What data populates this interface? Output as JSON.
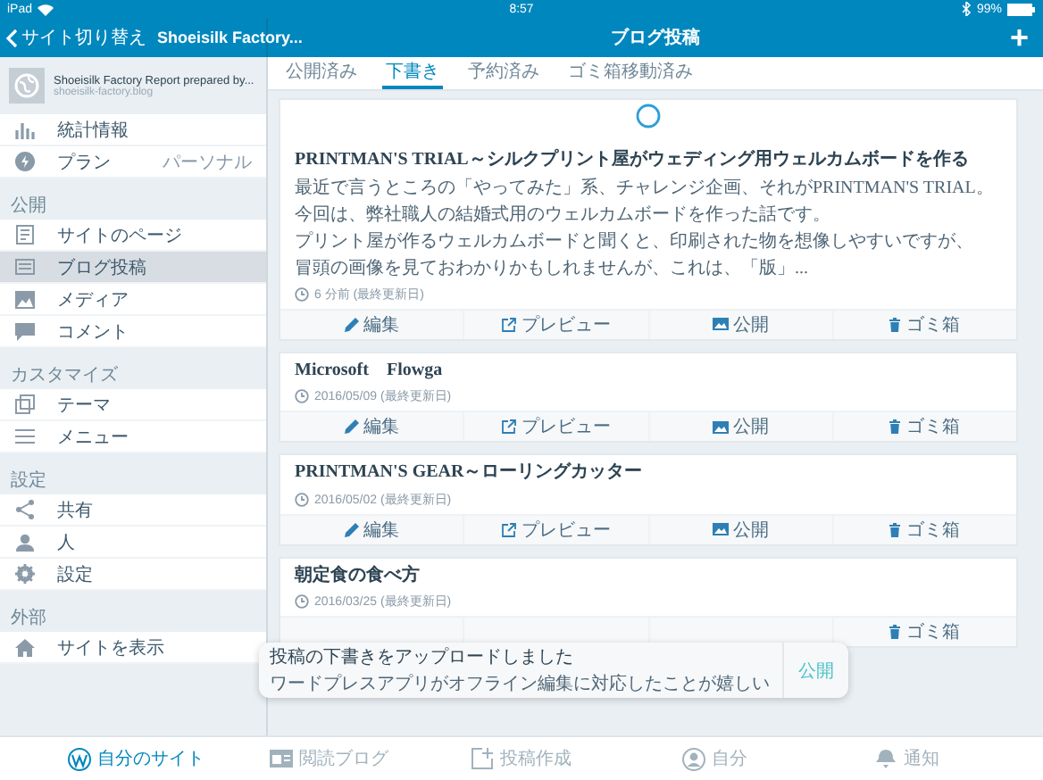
{
  "status_bar": {
    "device": "iPad",
    "time": "8:57",
    "battery": "99%"
  },
  "header": {
    "back": "サイト切り替え",
    "site": "Shoeisilk Factory...",
    "title": "ブログ投稿",
    "add": "+"
  },
  "site": {
    "name": "Shoeisilk Factory Report prepared by...",
    "url": "shoeisilk-factory.blog"
  },
  "sidebar": {
    "sections": [
      {
        "items": [
          {
            "label": "統計情報",
            "selected": false
          },
          {
            "label": "プラン",
            "value": "パーソナル",
            "selected": false
          }
        ]
      },
      {
        "title": "公開",
        "items": [
          {
            "label": "サイトのページ",
            "selected": false
          },
          {
            "label": "ブログ投稿",
            "selected": true
          },
          {
            "label": "メディア",
            "selected": false
          },
          {
            "label": "コメント",
            "selected": false
          }
        ]
      },
      {
        "title": "カスタマイズ",
        "items": [
          {
            "label": "テーマ",
            "selected": false
          },
          {
            "label": "メニュー",
            "selected": false
          }
        ]
      },
      {
        "title": "設定",
        "items": [
          {
            "label": "共有",
            "selected": false
          },
          {
            "label": "人",
            "selected": false
          },
          {
            "label": "設定",
            "selected": false
          }
        ]
      },
      {
        "title": "外部",
        "items": [
          {
            "label": "サイトを表示",
            "selected": false
          }
        ]
      }
    ]
  },
  "tabs": [
    {
      "label": "公開済み",
      "selected": false
    },
    {
      "label": "下書き",
      "selected": true
    },
    {
      "label": "予約済み",
      "selected": false
    },
    {
      "label": "ゴミ箱移動済み",
      "selected": false
    }
  ],
  "posts": [
    {
      "image_loading": true,
      "title": "PRINTMAN'S TRIAL～シルクプリント屋がウェディング用ウェルカムボードを作る",
      "excerpt": [
        "最近で言うところの「やってみた」系、チャレンジ企画、それがPRINTMAN'S TRIAL。",
        "今回は、弊社職人の結婚式用のウェルカムボードを作った話です。",
        "プリント屋が作るウェルカムボードと聞くと、印刷された物を想像しやすいですが、",
        "冒頭の画像を見ておわかりかもしれませんが、これは、「版」..."
      ],
      "meta": "6 分前 (最終更新日)",
      "actions": [
        {
          "kind": "edit",
          "label": "編集"
        },
        {
          "kind": "preview",
          "label": "プレビュー"
        },
        {
          "kind": "publish",
          "label": "公開"
        },
        {
          "kind": "trash",
          "label": "ゴミ箱"
        }
      ]
    },
    {
      "image_loading": false,
      "title": "Microsoft　Flowga",
      "meta": "2016/05/09 (最終更新日)",
      "actions": [
        {
          "kind": "edit",
          "label": "編集"
        },
        {
          "kind": "preview",
          "label": "プレビュー"
        },
        {
          "kind": "publish",
          "label": "公開"
        },
        {
          "kind": "trash",
          "label": "ゴミ箱"
        }
      ]
    },
    {
      "image_loading": false,
      "title": "PRINTMAN'S GEAR～ローリングカッター",
      "meta": "2016/05/02 (最終更新日)",
      "actions": [
        {
          "kind": "edit",
          "label": "編集"
        },
        {
          "kind": "preview",
          "label": "プレビュー"
        },
        {
          "kind": "publish",
          "label": "公開"
        },
        {
          "kind": "trash",
          "label": "ゴミ箱"
        }
      ]
    },
    {
      "image_loading": false,
      "title": "朝定食の食べ方",
      "meta": "2016/03/25 (最終更新日)",
      "actions": [
        {
          "kind": "trash",
          "label": "ゴミ箱"
        }
      ]
    }
  ],
  "toast": {
    "title": "投稿の下書きをアップロードしました",
    "message": "ワードプレスアプリがオフライン編集に対応したことが嬉しい",
    "action": "公開"
  },
  "bottom_tabs": [
    {
      "label": "自分のサイト",
      "selected": true
    },
    {
      "label": "閲読ブログ",
      "selected": false
    },
    {
      "label": "投稿作成",
      "selected": false
    },
    {
      "label": "自分",
      "selected": false
    },
    {
      "label": "通知",
      "selected": false
    }
  ]
}
